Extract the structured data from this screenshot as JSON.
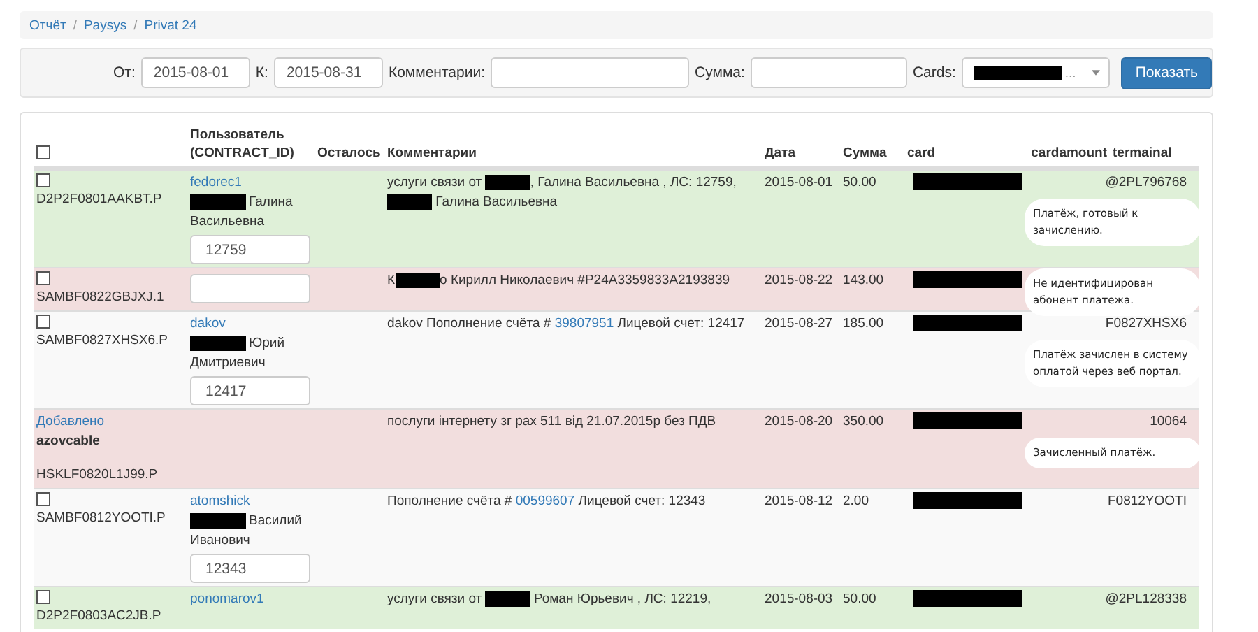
{
  "breadcrumb": {
    "separator": "/",
    "items": [
      {
        "label": "Отчёт"
      },
      {
        "label": "Paysys"
      },
      {
        "label": "Privat 24"
      }
    ]
  },
  "filters": {
    "from_label": "От:",
    "from_value": "2015-08-01",
    "to_label": "К:",
    "to_value": "2015-08-31",
    "comment_label": "Комментарии:",
    "sum_label": "Сумма:",
    "cards_label": "Cards:",
    "cards_suffix": "...",
    "submit": "Показать"
  },
  "table": {
    "select_all_checked": false,
    "columns": [
      "Пользователь (CONTRACT_ID)",
      "Осталось",
      "Комментарии",
      "Дата",
      "Сумма",
      "card",
      "cardamount",
      "termainal"
    ],
    "rows": [
      {
        "kind": "payment",
        "color": "#dff0d8",
        "checked": false,
        "contract_id": "D2P2F0801AAKBT.P",
        "user_link": "fedorec1",
        "name_lines": [
          "Галина",
          "Васильевна"
        ],
        "id_value": "12759",
        "comment": [
          {
            "kind": "text",
            "text": "услуги связи от "
          },
          {
            "kind": "redacted"
          },
          {
            "kind": "text",
            "text": ", Галина Васильевна , ЛС: 12759,"
          },
          {
            "kind": "redacted"
          },
          {
            "kind": "text",
            "text": " Галина Васильевна"
          }
        ],
        "date": "2015-08-01",
        "sum": "50.00",
        "terminal": "@2PL796768",
        "note": "Платёж, готовый к зачислению."
      },
      {
        "kind": "payment",
        "color": "#f2dede",
        "checked": false,
        "contract_id": "SAMBF0822GBJXJ.1",
        "id_value": "",
        "comment": [
          {
            "kind": "text",
            "text": "К"
          },
          {
            "kind": "redacted"
          },
          {
            "kind": "text",
            "text": "о Кирилл Николаевич #P24A3359833A2193839"
          }
        ],
        "date": "2015-08-22",
        "sum": "143.00",
        "note": "Не идентифицирован абонент платежа."
      },
      {
        "kind": "payment",
        "color": "#f9f9f9",
        "checked": false,
        "contract_id": "SAMBF0827XHSX6.P",
        "user_link": "dakov",
        "name_lines": [
          "Юрий",
          "Дмитриевич"
        ],
        "id_value": "12417",
        "comment": [
          {
            "kind": "text",
            "text": "dakov Пополнение счёта # "
          },
          {
            "kind": "link",
            "text": "39807951"
          },
          {
            "kind": "text",
            "text": " Лицевой счет: 12417"
          }
        ],
        "date": "2015-08-27",
        "sum": "185.00",
        "terminal": "F0827XHSX6",
        "note": "Платёж зачислен в систему оплатой через веб портал."
      },
      {
        "kind": "added",
        "color": "#f2dede",
        "added_link": "Добавлено",
        "added_user": "azovcable",
        "contract_id": "HSKLF0820L1J99.P",
        "comment": [
          {
            "kind": "text",
            "text": "послуги інтернету зг рах 511 від 21.07.2015р без ПДВ"
          }
        ],
        "date": "2015-08-20",
        "sum": "350.00",
        "terminal": "10064",
        "note": "Зачисленный платёж."
      },
      {
        "kind": "payment",
        "color": "#f9f9f9",
        "checked": false,
        "contract_id": "SAMBF0812YOOTI.P",
        "user_link": "atomshick",
        "name_lines": [
          "Василий",
          "Иванович"
        ],
        "id_value": "12343",
        "comment": [
          {
            "kind": "text",
            "text": "Пополнение счёта # "
          },
          {
            "kind": "link",
            "text": "00599607"
          },
          {
            "kind": "text",
            "text": " Лицевой счет: 12343"
          }
        ],
        "date": "2015-08-12",
        "sum": "2.00",
        "terminal": "F0812YOOTI"
      },
      {
        "kind": "payment",
        "color": "#dff0d8",
        "checked": false,
        "contract_id": "D2P2F0803AC2JB.P",
        "user_link": "ponomarov1",
        "comment": [
          {
            "kind": "text",
            "text": "услуги связи от "
          },
          {
            "kind": "redacted"
          },
          {
            "kind": "text",
            "text": " Роман Юрьевич , ЛС: 12219,"
          }
        ],
        "date": "2015-08-03",
        "sum": "50.00",
        "terminal": "@2PL128338"
      }
    ]
  }
}
